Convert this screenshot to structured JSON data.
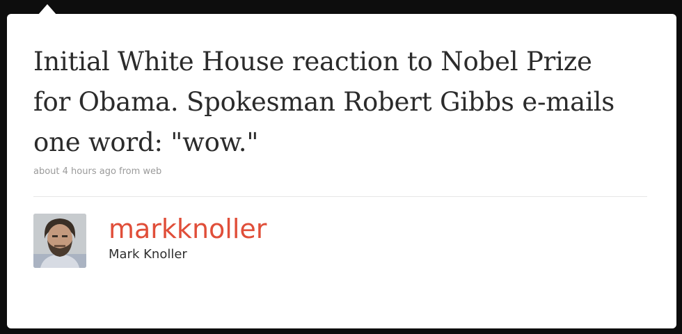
{
  "tweet": {
    "text": "Initial White House reaction to Nobel Prize for Obama. Spokesman Robert Gibbs e-mails one word: \"wow.\"",
    "meta": "about 4 hours ago from web"
  },
  "author": {
    "username": "markknoller",
    "full_name": "Mark Knoller",
    "avatar_icon": "profile-photo"
  },
  "colors": {
    "username": "#e04e39",
    "text": "#2b2b2b",
    "meta": "#9a9a9a",
    "background": "#0d0d0d",
    "card": "#ffffff"
  }
}
